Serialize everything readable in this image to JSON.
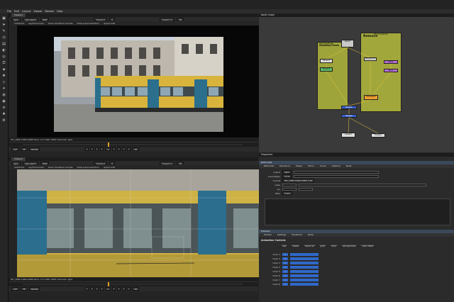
{
  "menu": [
    "File",
    "Edit",
    "Layout",
    "Viewer",
    "Render",
    "Help"
  ],
  "left_toolbar_icons": [
    "viewer-icon",
    "pointer-icon",
    "draw-icon",
    "time-icon",
    "channel-icon",
    "color-icon",
    "filter-icon",
    "keyer-icon",
    "merge-icon",
    "transform-icon",
    "3d-icon",
    "particles-icon",
    "deep-icon",
    "views-icon",
    "metadata-icon",
    "toolsets-icon",
    "other-icon"
  ],
  "viewer1": {
    "tab": "Viewer1",
    "bar": [
      "rgba",
      "rgba.alpha",
      "RGB",
      "Tracker1",
      "A",
      "Viewer1.2",
      "2D"
    ],
    "bar2": [
      "autotrack",
      "keyframe fuze",
      "show transform handle",
      "allow panel selection",
      "layout edit"
    ],
    "status": "HD_1080 1920x1080 bbox: 0 0 1920 1080 channels: rgba",
    "timeline_ticks": [
      "1",
      "10",
      "20",
      "30",
      "40",
      "50",
      "60",
      "70",
      "80",
      "90",
      "100",
      "110",
      "120",
      "130",
      "140"
    ],
    "transport": [
      "24*",
      "TF",
      "Global",
      "1",
      "10"
    ]
  },
  "viewer2": {
    "tab": "Viewer2",
    "bar": [
      "rgba",
      "rgba.alpha",
      "RGB",
      "Tracker1",
      "A",
      "Viewer2.2",
      "2D"
    ],
    "bar2": [
      "autotrack",
      "keyframe fuze",
      "show transform handle",
      "allow panel selection",
      "layout edit"
    ],
    "status": "HD_1080 1920x1080 bbox: 0 0 1920 1080 channels: rgba",
    "timeline_ticks": [
      "1",
      "10",
      "20",
      "30",
      "40",
      "50",
      "60",
      "70",
      "80",
      "90",
      "100",
      "110",
      "120",
      "130",
      "140"
    ],
    "transport": [
      "24*",
      "TF",
      "Global",
      "1",
      "10"
    ]
  },
  "nodegraph": {
    "title": "Node Graph",
    "backdrops": [
      {
        "label": "BackdropNode1",
        "title": "Stabilize/Track"
      },
      {
        "label": "BackdropNode2",
        "title": "Remove"
      }
    ],
    "nodes": [
      "Read1",
      "Tracker1",
      "Tracker2",
      "Transform1",
      "Roto1",
      "Blur1",
      "RotoPaint1",
      "Merge1",
      "Merge2",
      "Viewer1",
      "Viewer2"
    ]
  },
  "properties": {
    "title": "Properties",
    "node1": "Reformat1",
    "tabs1": [
      "Reformat",
      "Transform",
      "Shape",
      "Mirror",
      "Clone",
      "Lifetime",
      "Node"
    ],
    "rows1": [
      {
        "label": "output",
        "value": "rgba"
      },
      {
        "label": "premultiply",
        "value": "none"
      },
      {
        "label": "format",
        "value": "HD_1080 1920x1080 1.00"
      },
      {
        "label": "scale",
        "value": "1"
      },
      {
        "label": "x/y",
        "value": "0"
      },
      {
        "label": "filter",
        "value": "Cubic"
      }
    ],
    "node2": "Tracker1",
    "tabs2": [
      "Tracker",
      "Settings",
      "Transform",
      "Node"
    ],
    "section": "Animation Controls",
    "tracks": [
      "track 1",
      "track 2",
      "track 3",
      "track 4",
      "track 5",
      "track 6",
      "track 7",
      "track 8"
    ],
    "btns": [
      "add",
      "delete",
      "select all",
      "grab",
      "clear",
      "set keyframe",
      "clear offset"
    ]
  }
}
